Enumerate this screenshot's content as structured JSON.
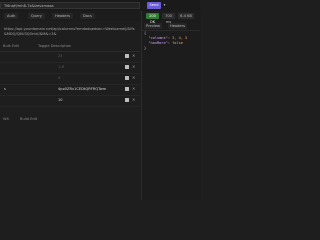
{
  "request": {
    "url_short": "Ti6nqH/mh8-7z&lzevxmaoa",
    "full_url": "https://api.yourdomain.net/api/columns?emdadqedsec=Weeluamelj/&ffs&MDQ/Q6U3QOmV/&M&=3&",
    "send_label": "Send",
    "caret": "▾"
  },
  "tabs": [
    "Auth",
    "Query",
    "Headers",
    "Docs"
  ],
  "params_header": {
    "bulk_edit": "Bulk Edit",
    "toggle_description": "Toggle Description"
  },
  "params": [
    {
      "name": "",
      "value": "25",
      "checked": true
    },
    {
      "name": "",
      "value": "1-8",
      "checked": true
    },
    {
      "name": "",
      "value": "5",
      "checked": true
    },
    {
      "name": "s",
      "value": "4po5ZRv1CEDtQRFRQTwm",
      "checked": true
    },
    {
      "name": "",
      "value": "10",
      "checked": true
    }
  ],
  "bottom_bar": {
    "left": "WX",
    "right": "Build Edit"
  },
  "response": {
    "status": "200 OK",
    "time": "700 ms",
    "size": "6.4 KB",
    "tabs": [
      "Preview",
      "Headers"
    ],
    "json_lines": [
      {
        "type": "punc",
        "text": "{"
      },
      {
        "type": "kv",
        "key": "\"columns\"",
        "val": "3, 4, 5"
      },
      {
        "type": "kv",
        "key": "\"hasMore\"",
        "val": "false"
      },
      {
        "type": "punc",
        "text": "}"
      }
    ]
  },
  "colors": {
    "send": "#6a5bd6",
    "status_ok": "#2f7d32",
    "json_key": "#d3a1ff",
    "json_num": "#f0a35a"
  }
}
